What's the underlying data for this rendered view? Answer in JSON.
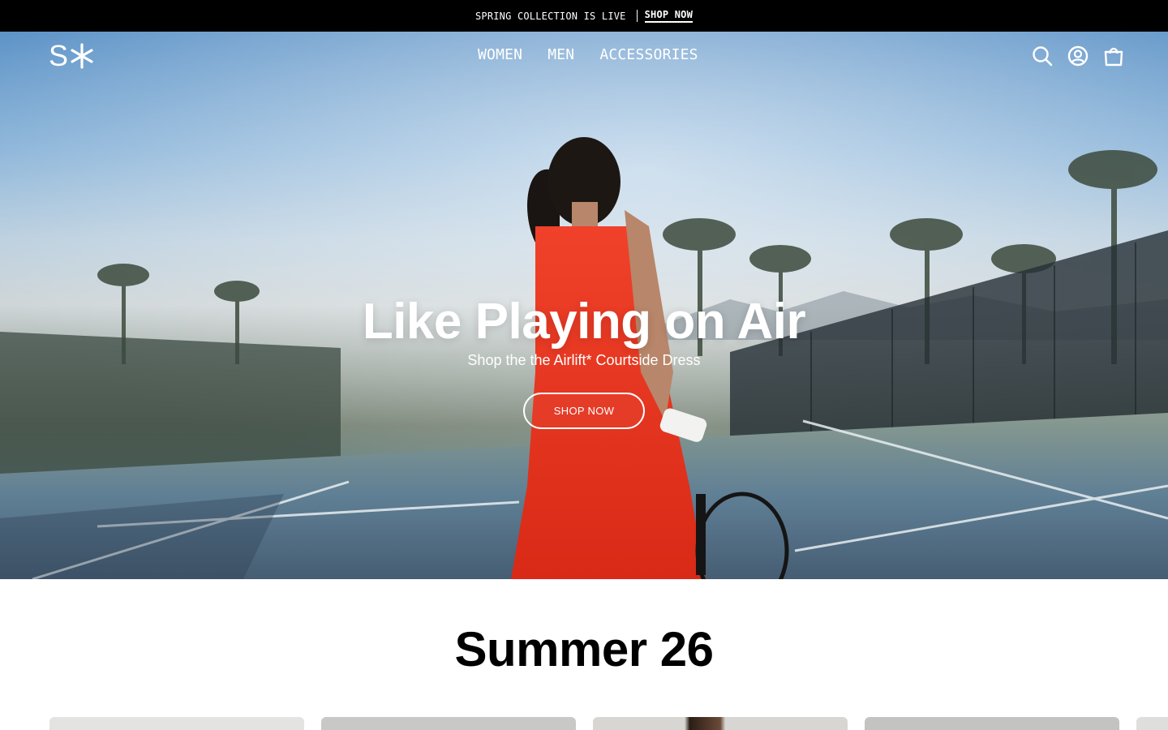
{
  "announcement": {
    "message": "SPRING COLLECTION IS LIVE",
    "link_label": "SHOP NOW"
  },
  "header": {
    "logo_text": "S",
    "nav": [
      {
        "label": "WOMEN"
      },
      {
        "label": "MEN"
      },
      {
        "label": "ACCESSORIES"
      }
    ],
    "icons": [
      "search-icon",
      "account-icon",
      "cart-icon"
    ]
  },
  "hero": {
    "title": "Like Playing on Air",
    "subtitle": "Shop the the Airlift* Courtside Dress",
    "cta_label": "SHOP NOW"
  },
  "section": {
    "title": "Summer 26",
    "cards": [
      {
        "color": "#e4e4e2"
      },
      {
        "color": "#c9c9c7"
      },
      {
        "color": "#d6d4d0"
      },
      {
        "color": "#c3c3c1"
      },
      {
        "color": "#dededc"
      }
    ]
  },
  "colors": {
    "announcement_bg": "#000000",
    "text_on_dark": "#ffffff",
    "page_bg": "#ffffff",
    "dress_red": "#e8321f"
  }
}
